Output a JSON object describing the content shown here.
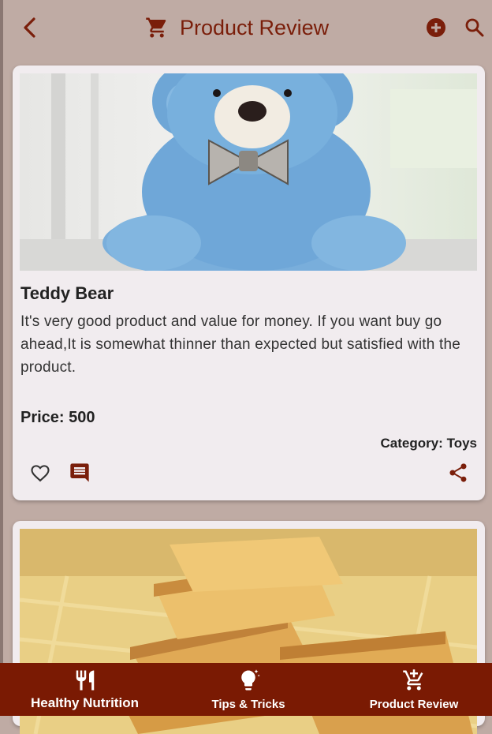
{
  "colors": {
    "accent": "#7a1e0a",
    "background": "#bfaba4",
    "card": "#f1ecef",
    "nav": "#7a1a03"
  },
  "appbar": {
    "title": "Product Review",
    "icons": [
      "back-arrow-icon",
      "cart-icon",
      "add-circle-icon",
      "search-icon"
    ]
  },
  "products": [
    {
      "name": "Teddy Bear",
      "description": "It's very good product and value for money. If you want buy go ahead,It is somewhat thinner than expected but satisfied with the product.",
      "price": "Price: 500",
      "category": "Category: Toys",
      "image": "blue-teddy-bear-photo"
    },
    {
      "image": "rusk-toast-photo"
    }
  ],
  "bottom_nav": [
    {
      "label": "Healthy Nutrition",
      "icon": "fork-knife-icon"
    },
    {
      "label": "Tips & Tricks",
      "icon": "lightbulb-icon"
    },
    {
      "label": "Product Review",
      "icon": "add-cart-icon"
    }
  ]
}
